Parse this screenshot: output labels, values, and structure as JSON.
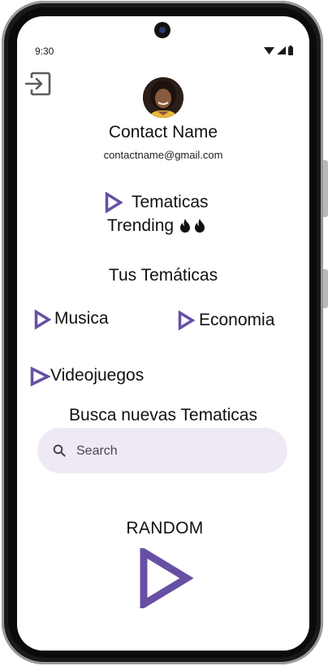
{
  "status_bar": {
    "time": "9:30"
  },
  "profile": {
    "name": "Contact Name",
    "email": "contactname@gmail.com"
  },
  "trending": {
    "title": "Tematicas",
    "subtitle": "Trending"
  },
  "my_topics": {
    "title": "Tus Temáticas",
    "items": [
      "Musica",
      "Economia",
      "Videojuegos"
    ]
  },
  "discover": {
    "title": "Busca nuevas Tematicas",
    "search_placeholder": "Search"
  },
  "random": {
    "label": "RANDOM"
  },
  "colors": {
    "accent": "#6750a4",
    "search_bg": "#efe9f5",
    "text": "#111111"
  },
  "icons": [
    "logout-icon",
    "play-triangle-icon",
    "flame-icon",
    "search-icon",
    "wifi-icon",
    "signal-icon",
    "battery-icon"
  ]
}
